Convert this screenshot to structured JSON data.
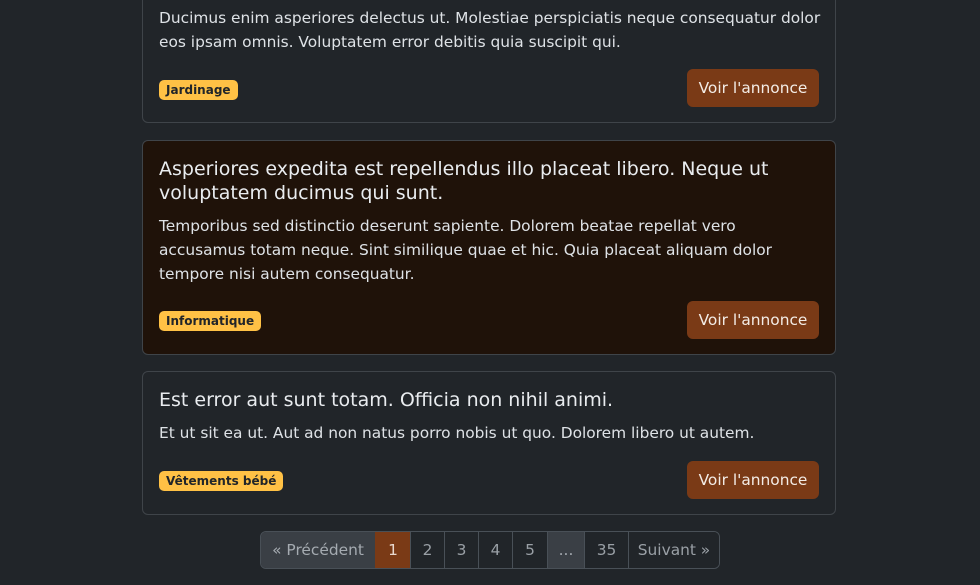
{
  "cards": [
    {
      "title": "",
      "text": "Ducimus enim asperiores delectus ut. Molestiae perspiciatis neque consequatur dolor eos ipsam omnis. Voluptatem error debitis quia suscipit qui.",
      "badge": "Jardinage",
      "button": "Voir l'annonce"
    },
    {
      "title": "Asperiores expedita est repellendus illo placeat libero. Neque ut voluptatem ducimus qui sunt.",
      "text": "Temporibus sed distinctio deserunt sapiente. Dolorem beatae repellat vero accusamus totam neque. Sint similique quae et hic. Quia placeat aliquam dolor tempore nisi autem consequatur.",
      "badge": "Informatique",
      "button": "Voir l'annonce"
    },
    {
      "title": "Est error aut sunt totam. Officia non nihil animi.",
      "text": "Et ut sit ea ut. Aut ad non natus porro nobis ut quo. Dolorem libero ut autem.",
      "badge": "Vêtements bébé",
      "button": "Voir l'annonce"
    }
  ],
  "pagination": {
    "prev": "« Précédent",
    "pages": [
      "1",
      "2",
      "3",
      "4",
      "5"
    ],
    "ellipsis": "...",
    "last": "35",
    "next": "Suivant »",
    "current": "1"
  },
  "colors": {
    "background": "#212529",
    "accent": "#7a3a16",
    "badge": "#ffc145",
    "highlight_card": "#1f1209"
  }
}
